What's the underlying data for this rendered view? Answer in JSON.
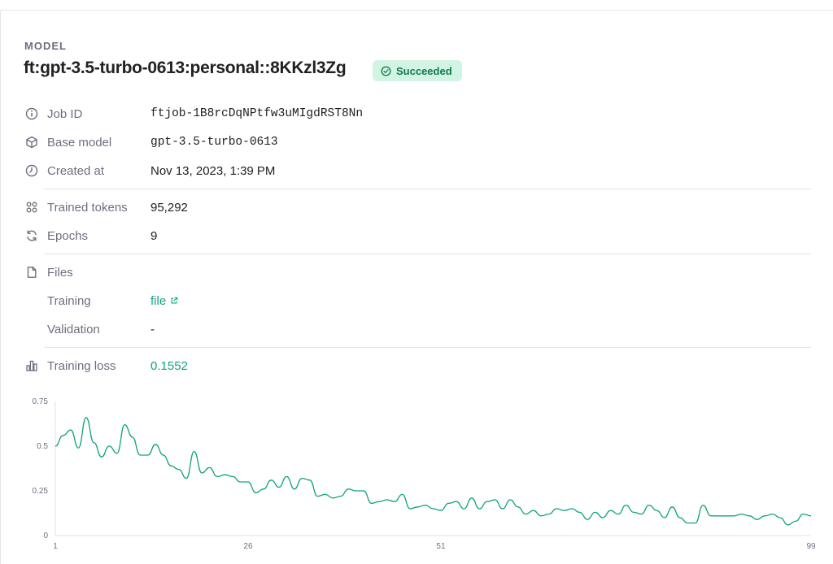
{
  "section_label": "MODEL",
  "model_name": "ft:gpt-3.5-turbo-0613:personal::8KKzl3Zg",
  "status": {
    "label": "Succeeded",
    "color": "#10a37f",
    "background": "#d2f4e3"
  },
  "details": {
    "job_id": {
      "label": "Job ID",
      "value": "ftjob-1B8rcDqNPtfw3uMIgdRST8Nn"
    },
    "base_model": {
      "label": "Base model",
      "value": "gpt-3.5-turbo-0613"
    },
    "created_at": {
      "label": "Created at",
      "value": "Nov 13, 2023, 1:39 PM"
    },
    "trained_tokens": {
      "label": "Trained tokens",
      "value": "95,292"
    },
    "epochs": {
      "label": "Epochs",
      "value": "9"
    },
    "files": {
      "label": "Files"
    },
    "training": {
      "label": "Training",
      "value": "file"
    },
    "validation": {
      "label": "Validation",
      "value": "-"
    },
    "training_loss": {
      "label": "Training loss",
      "value": "0.1552"
    }
  },
  "icons": {
    "job_id": "info-icon",
    "base_model": "cube-icon",
    "created_at": "clock-icon",
    "trained_tokens": "grid-icon",
    "epochs": "refresh-icon",
    "files": "file-icon",
    "training_link": "external-link-icon",
    "training_loss": "bar-chart-icon",
    "status": "check-circle-icon"
  },
  "chart_data": {
    "type": "line",
    "x_ticks": [
      "1",
      "26",
      "51",
      "99"
    ],
    "y_ticks": [
      "0",
      "0.25",
      "0.5",
      "0.75"
    ],
    "xlim": [
      1,
      99
    ],
    "ylim": [
      0,
      0.75
    ],
    "grid": false,
    "line_color": "#10a37f",
    "series": [
      {
        "x": [
          1,
          2,
          3,
          4,
          5,
          6,
          7,
          8,
          9,
          10,
          11,
          12,
          13,
          14,
          15,
          16,
          17,
          18,
          19,
          20,
          21,
          22,
          23,
          24,
          25,
          26,
          27,
          28,
          29,
          30,
          31,
          32,
          33,
          34,
          35,
          36,
          37,
          38,
          39,
          40,
          41,
          42,
          43,
          44,
          45,
          46,
          47,
          48,
          49,
          50,
          51,
          52,
          53,
          54,
          55,
          56,
          57,
          58,
          59,
          60,
          61,
          62,
          63,
          64,
          65,
          66,
          67,
          68,
          69,
          70,
          71,
          72,
          73,
          74,
          75,
          76,
          77,
          78,
          79,
          80,
          81,
          82,
          83,
          84,
          85,
          86,
          87,
          88,
          89,
          90,
          91,
          92,
          93,
          94,
          95,
          96,
          97,
          98,
          99
        ],
        "y": [
          0.5,
          0.56,
          0.59,
          0.49,
          0.66,
          0.52,
          0.44,
          0.5,
          0.46,
          0.62,
          0.55,
          0.45,
          0.45,
          0.51,
          0.45,
          0.39,
          0.37,
          0.32,
          0.47,
          0.35,
          0.38,
          0.33,
          0.34,
          0.33,
          0.3,
          0.3,
          0.24,
          0.26,
          0.31,
          0.27,
          0.33,
          0.26,
          0.32,
          0.31,
          0.22,
          0.23,
          0.21,
          0.22,
          0.26,
          0.25,
          0.25,
          0.18,
          0.19,
          0.2,
          0.19,
          0.23,
          0.15,
          0.16,
          0.17,
          0.15,
          0.14,
          0.18,
          0.19,
          0.15,
          0.21,
          0.15,
          0.19,
          0.2,
          0.15,
          0.2,
          0.16,
          0.12,
          0.14,
          0.11,
          0.12,
          0.15,
          0.14,
          0.15,
          0.13,
          0.09,
          0.13,
          0.1,
          0.14,
          0.12,
          0.17,
          0.13,
          0.12,
          0.17,
          0.14,
          0.1,
          0.16,
          0.1,
          0.07,
          0.07,
          0.17,
          0.11,
          0.11,
          0.11,
          0.11,
          0.12,
          0.11,
          0.09,
          0.11,
          0.12,
          0.1,
          0.06,
          0.08,
          0.12,
          0.11
        ]
      }
    ]
  }
}
